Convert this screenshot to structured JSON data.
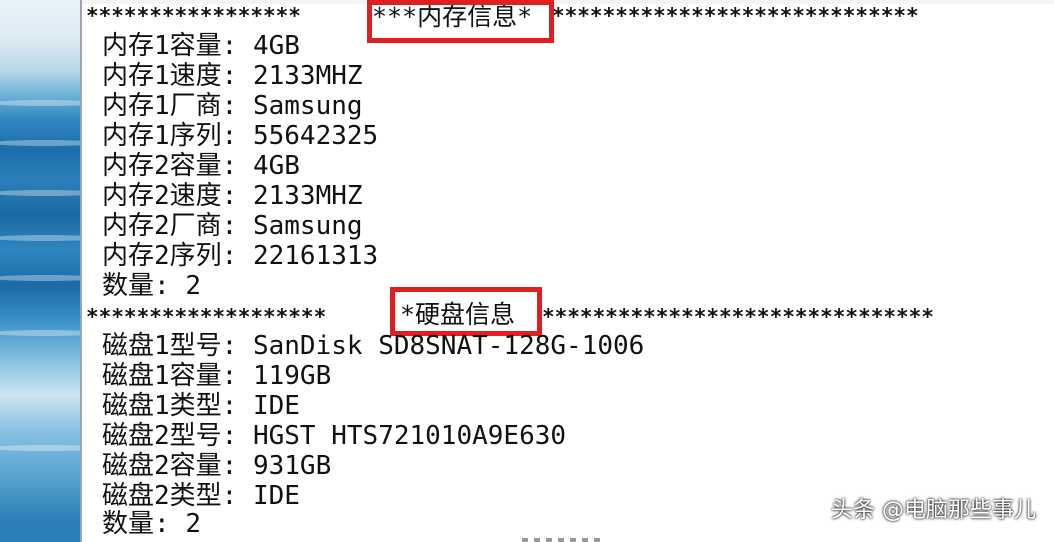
{
  "memory_section": {
    "title": "内存信息",
    "title_marker": "***内存信息*",
    "stars_left": "*****************",
    "stars_right": "*****************************",
    "lines": [
      {
        "label": "内存1容量:",
        "value": "4GB"
      },
      {
        "label": "内存1速度:",
        "value": "2133MHZ"
      },
      {
        "label": "内存1厂商:",
        "value": "Samsung"
      },
      {
        "label": "内存1序列:",
        "value": "55642325"
      },
      {
        "label": "内存2容量:",
        "value": "4GB"
      },
      {
        "label": "内存2速度:",
        "value": "2133MHZ"
      },
      {
        "label": "内存2厂商:",
        "value": "Samsung"
      },
      {
        "label": "内存2序列:",
        "value": "22161313"
      }
    ],
    "count_label": "数量:",
    "count_value": "2"
  },
  "disk_section": {
    "title": "硬盘信息",
    "title_marker": "*硬盘信息",
    "stars_left": "*******************",
    "stars_right": "*******************************",
    "lines": [
      {
        "label": "磁盘1型号:",
        "value": "SanDisk SD8SNAT-128G-1006"
      },
      {
        "label": "磁盘1容量:",
        "value": "119GB"
      },
      {
        "label": "磁盘1类型:",
        "value": "IDE"
      },
      {
        "label": "磁盘2型号:",
        "value": "HGST HTS721010A9E630"
      },
      {
        "label": "磁盘2容量:",
        "value": "931GB"
      },
      {
        "label": "磁盘2类型:",
        "value": "IDE"
      }
    ],
    "count_label": "数量:",
    "count_value": "2"
  },
  "watermark": "头条 @电脑那些事儿",
  "colors": {
    "highlight": "#e02020",
    "text": "#111111",
    "background": "#ffffff"
  }
}
